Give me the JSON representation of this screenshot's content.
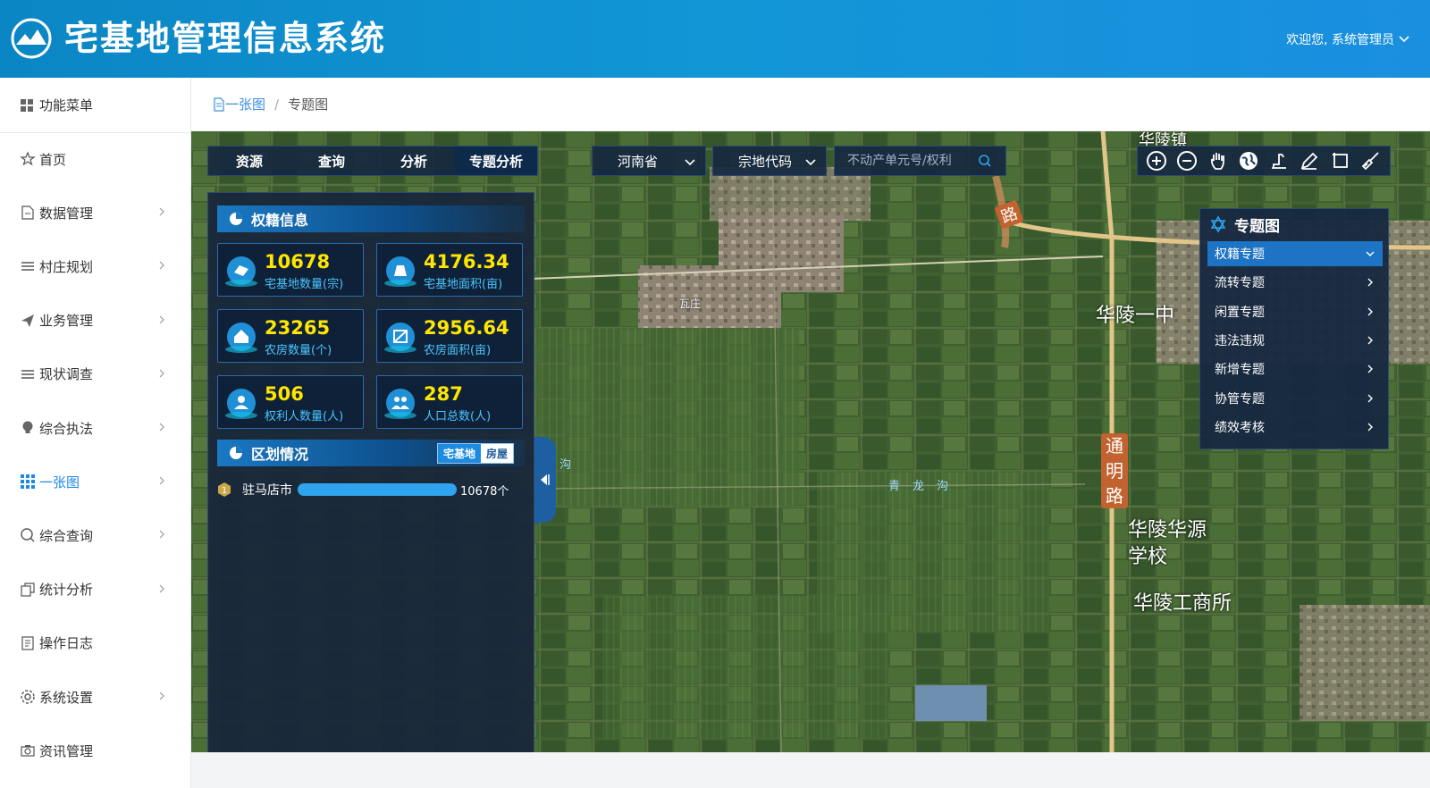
{
  "header": {
    "title": "宅基地管理信息系统",
    "welcome": "欢迎您, 系统管理员"
  },
  "sidebar": {
    "menu_title": "功能菜单",
    "items": [
      {
        "label": "首页",
        "icon": "star-icon",
        "has_children": false
      },
      {
        "label": "数据管理",
        "icon": "document-icon",
        "has_children": true
      },
      {
        "label": "村庄规划",
        "icon": "list-icon",
        "has_children": true
      },
      {
        "label": "业务管理",
        "icon": "send-icon",
        "has_children": true
      },
      {
        "label": "现状调查",
        "icon": "list-icon",
        "has_children": true
      },
      {
        "label": "综合执法",
        "icon": "bulb-icon",
        "has_children": true
      },
      {
        "label": "一张图",
        "icon": "grid-icon",
        "has_children": true,
        "active": true
      },
      {
        "label": "综合查询",
        "icon": "search-icon",
        "has_children": true
      },
      {
        "label": "统计分析",
        "icon": "copy-icon",
        "has_children": true
      },
      {
        "label": "操作日志",
        "icon": "log-icon",
        "has_children": false
      },
      {
        "label": "系统设置",
        "icon": "gear-icon",
        "has_children": true
      },
      {
        "label": "资讯管理",
        "icon": "camera-icon",
        "has_children": false
      }
    ]
  },
  "breadcrumb": {
    "root": "一张图",
    "sep": "/",
    "current": "专题图"
  },
  "map_toolbar": {
    "tabs": [
      "资源",
      "查询",
      "分析",
      "专题分析"
    ],
    "active_tab": "专题分析",
    "province": "河南省",
    "code_field": "宗地代码",
    "search_placeholder": "不动产单元号/权利"
  },
  "panel": {
    "section1_title": "权籍信息",
    "stats": [
      {
        "value": "10678",
        "label": "宅基地数量(宗)"
      },
      {
        "value": "4176.34",
        "label": "宅基地面积(亩)"
      },
      {
        "value": "23265",
        "label": "农房数量(个)"
      },
      {
        "value": "2956.64",
        "label": "农房面积(亩)"
      },
      {
        "value": "506",
        "label": "权利人数量(人)"
      },
      {
        "value": "287",
        "label": "人口总数(人)"
      }
    ],
    "section2_title": "区划情况",
    "toggle": [
      "宅基地",
      "房屋"
    ],
    "ranking": [
      {
        "rank": "1",
        "name": "驻马店市",
        "count": "10678个",
        "fraction": 1.0
      }
    ]
  },
  "theme_panel": {
    "title": "专题图",
    "items": [
      "权籍专题",
      "流转专题",
      "闲置专题",
      "违法违规",
      "新增专题",
      "协管专题",
      "绩效考核"
    ],
    "active": "权籍专题"
  },
  "map_labels": [
    "华陵一中",
    "华陵华源",
    "学校",
    "华陵工商所",
    "通",
    "明",
    "路",
    "华陵镇",
    "青龙沟",
    "沟",
    "路",
    "瓦庄"
  ],
  "colors": {
    "header": "#0b86c4",
    "active_menu": "#1e88e5",
    "stat_value": "#ffe600",
    "stat_label": "#49c6ff",
    "panel_bg": "#18263a"
  }
}
